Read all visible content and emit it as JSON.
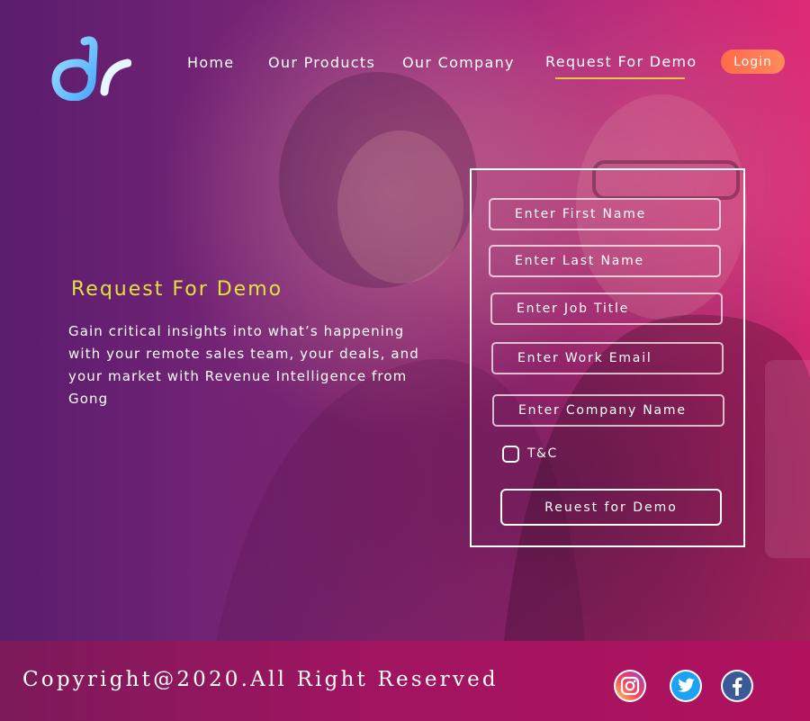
{
  "header": {
    "nav": [
      {
        "label": "Home"
      },
      {
        "label": "Our Products"
      },
      {
        "label": "Our Company"
      },
      {
        "label": "Request For Demo"
      }
    ],
    "login_label": "Login"
  },
  "hero": {
    "title": "Request For Demo",
    "description": "Gain critical insights into what’s happening with your remote sales team, your deals, and your market with Revenue Intelligence from Gong"
  },
  "form": {
    "fields": [
      {
        "placeholder": "Enter First Name"
      },
      {
        "placeholder": "Enter Last Name"
      },
      {
        "placeholder": "Enter Job Title"
      },
      {
        "placeholder": "Enter Work Email"
      },
      {
        "placeholder": "Enter Company Name"
      }
    ],
    "tc_label": "T&C",
    "tc_checked": false,
    "submit_label": "Reuest for Demo"
  },
  "footer": {
    "copyright": "Copyright@2020.All Right Reserved",
    "social": [
      {
        "icon": "instagram-icon"
      },
      {
        "icon": "twitter-icon"
      },
      {
        "icon": "facebook-icon"
      }
    ]
  },
  "colors": {
    "accent_title": "#e2e23c",
    "nav_underline": "#e8c64a",
    "login_button": "#ff7a52",
    "footer_bg": "#a01460"
  }
}
